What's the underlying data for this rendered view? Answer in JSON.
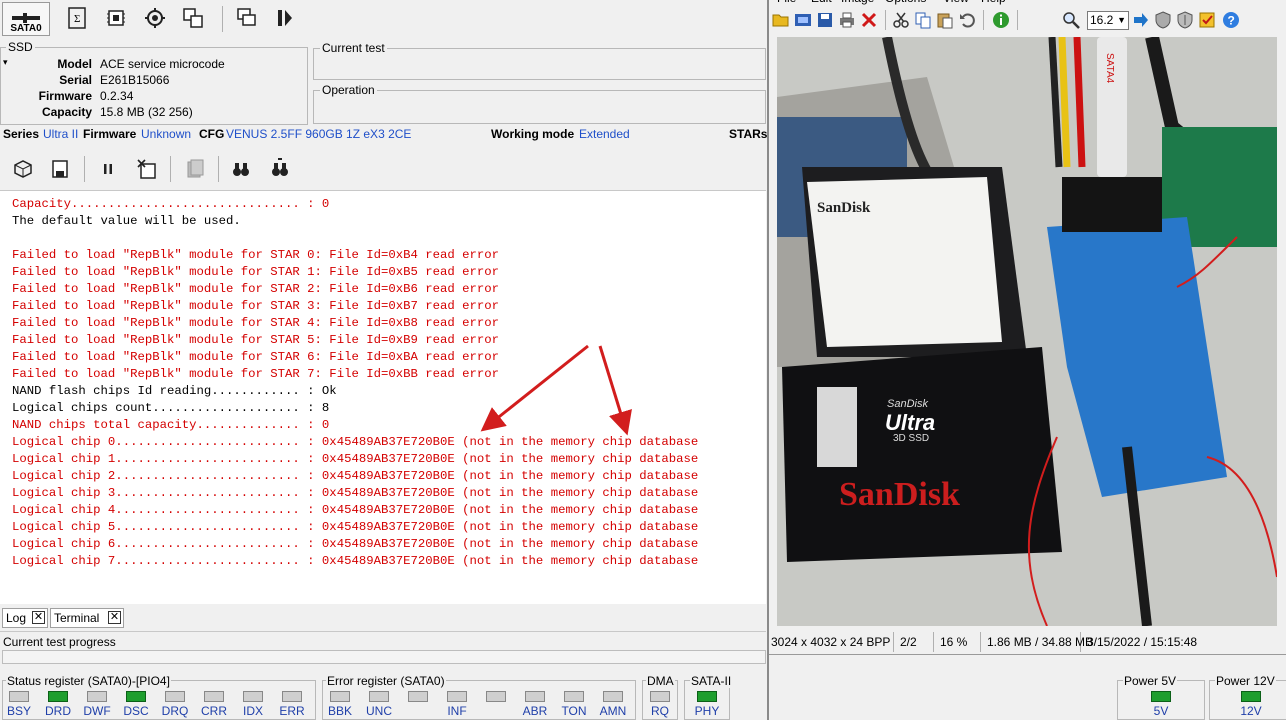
{
  "toolbar": {
    "sata_port": "SATA0",
    "icons": [
      "terminal-icon",
      "chip-icon",
      "gear-chip-icon",
      "copy-chip-icon",
      "windows-icon",
      "step-icon"
    ]
  },
  "info": {
    "section": "SSD",
    "model_label": "Model",
    "model_value": "ACE service microcode",
    "serial_label": "Serial",
    "serial_value": "E261B15066",
    "firmware_label": "Firmware",
    "firmware_value": "0.2.34",
    "capacity_label": "Capacity",
    "capacity_value": "15.8 MB (32 256)"
  },
  "current_test_label": "Current test",
  "operation_label": "Operation",
  "config_bar": {
    "series_label": "Series",
    "series_value": "Ultra II",
    "firmware_label": "Firmware",
    "firmware_value": "Unknown",
    "cfg_label": "CFG",
    "cfg_value": "VENUS 2.5FF 960GB 1Z eX3 2CE",
    "mode_label": "Working mode",
    "mode_value": "Extended",
    "stars_label": "STARs"
  },
  "log_lines": [
    {
      "text": "Capacity............................... : 0",
      "c": "red"
    },
    {
      "text": "The default value will be used.",
      "c": "blk"
    },
    {
      "text": "",
      "c": "blk"
    },
    {
      "text": "Failed to load \"RepBlk\" module for STAR 0: File Id=0xB4 read error",
      "c": "red"
    },
    {
      "text": "Failed to load \"RepBlk\" module for STAR 1: File Id=0xB5 read error",
      "c": "red"
    },
    {
      "text": "Failed to load \"RepBlk\" module for STAR 2: File Id=0xB6 read error",
      "c": "red"
    },
    {
      "text": "Failed to load \"RepBlk\" module for STAR 3: File Id=0xB7 read error",
      "c": "red"
    },
    {
      "text": "Failed to load \"RepBlk\" module for STAR 4: File Id=0xB8 read error",
      "c": "red"
    },
    {
      "text": "Failed to load \"RepBlk\" module for STAR 5: File Id=0xB9 read error",
      "c": "red"
    },
    {
      "text": "Failed to load \"RepBlk\" module for STAR 6: File Id=0xBA read error",
      "c": "red"
    },
    {
      "text": "Failed to load \"RepBlk\" module for STAR 7: File Id=0xBB read error",
      "c": "red"
    },
    {
      "text": "NAND flash chips Id reading............ : Ok",
      "c": "blk"
    },
    {
      "text": "Logical chips count.................... : 8",
      "c": "blk"
    },
    {
      "text": "NAND chips total capacity.............. : 0",
      "c": "red"
    },
    {
      "text": "Logical chip 0......................... : 0x45489AB37E720B0E (not in the memory chip database",
      "c": "red"
    },
    {
      "text": "Logical chip 1......................... : 0x45489AB37E720B0E (not in the memory chip database",
      "c": "red"
    },
    {
      "text": "Logical chip 2......................... : 0x45489AB37E720B0E (not in the memory chip database",
      "c": "red"
    },
    {
      "text": "Logical chip 3......................... : 0x45489AB37E720B0E (not in the memory chip database",
      "c": "red"
    },
    {
      "text": "Logical chip 4......................... : 0x45489AB37E720B0E (not in the memory chip database",
      "c": "red"
    },
    {
      "text": "Logical chip 5......................... : 0x45489AB37E720B0E (not in the memory chip database",
      "c": "red"
    },
    {
      "text": "Logical chip 6......................... : 0x45489AB37E720B0E (not in the memory chip database",
      "c": "red"
    },
    {
      "text": "Logical chip 7......................... : 0x45489AB37E720B0E (not in the memory chip database",
      "c": "red"
    }
  ],
  "tabs": {
    "log": "Log",
    "terminal": "Terminal"
  },
  "progress_label": "Current test progress",
  "status_register": {
    "title": "Status register (SATA0)-[PIO4]",
    "bits": [
      {
        "name": "BSY",
        "on": false
      },
      {
        "name": "DRD",
        "on": true
      },
      {
        "name": "DWF",
        "on": false
      },
      {
        "name": "DSC",
        "on": true
      },
      {
        "name": "DRQ",
        "on": false
      },
      {
        "name": "CRR",
        "on": false
      },
      {
        "name": "IDX",
        "on": false
      },
      {
        "name": "ERR",
        "on": false
      }
    ]
  },
  "error_register": {
    "title": "Error register (SATA0)",
    "bits": [
      {
        "name": "BBK",
        "on": false
      },
      {
        "name": "UNC",
        "on": false
      },
      {
        "name": "",
        "on": false
      },
      {
        "name": "INF",
        "on": false
      },
      {
        "name": "",
        "on": false
      },
      {
        "name": "ABR",
        "on": false
      },
      {
        "name": "TON",
        "on": false
      },
      {
        "name": "AMN",
        "on": false
      }
    ]
  },
  "dma": {
    "title": "DMA",
    "bit": "RQ"
  },
  "sata2": {
    "title": "SATA-II",
    "bit": "PHY"
  },
  "power5": {
    "title": "Power 5V",
    "value": "5V"
  },
  "power12": {
    "title": "Power 12V",
    "value": "12V"
  },
  "viewer": {
    "menu": [
      "File",
      "Edit",
      "Image",
      "Options",
      "View",
      "Help"
    ],
    "zoom": "16.2",
    "status": {
      "dims": "3024 x 4032 x 24 BPP",
      "page": "2/2",
      "zoom_pct": "16 %",
      "size": "1.86 MB / 34.88 MB",
      "date": "3/15/2022 / 15:15:48"
    },
    "photo_labels": {
      "sandisk_label_brand": "SanDisk",
      "ultra_brand": "SanDisk",
      "ultra_model": "Ultra",
      "ultra_sub": "3D SSD",
      "ultra_logo": "SanDisk",
      "cable": "SATA4"
    }
  },
  "colors": {
    "log_red": "#d40000",
    "link_blue": "#1f4fc9",
    "led_green": "#1e9e2e"
  }
}
